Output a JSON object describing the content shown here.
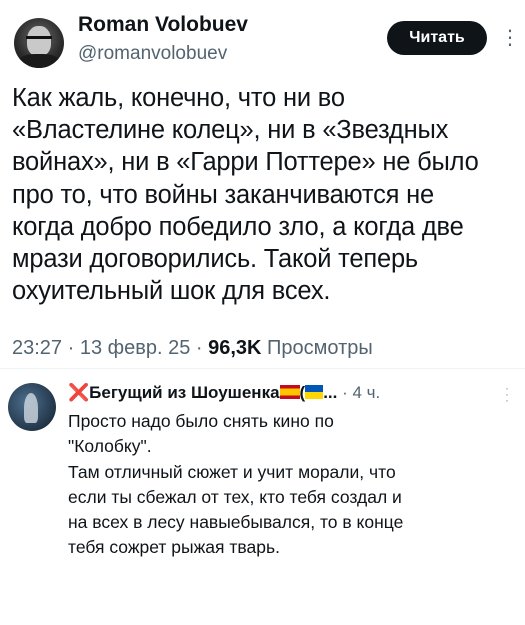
{
  "tweet": {
    "author_name": "Roman Volobuev",
    "author_handle": "@romanvolobuev",
    "follow_label": "Читать",
    "more_icon": "more-icon",
    "lines": [
      "Как жаль, конечно, что ни во",
      "«Властелине колец», ни в «Звездных",
      "войнах», ни в «Гарри Поттере» не было",
      "про то, что войны заканчиваются не",
      "когда добро победило зло, а когда две",
      "мрази договорились. Такой теперь",
      "охуительный шок для всех."
    ],
    "time": "23:27 · 13 февр. 25 · ",
    "views_count": "96,3K",
    "views_label": " Просмотры"
  },
  "reply": {
    "x_mark": "❌",
    "name": "Бегущий из Шоушенка",
    "name_suffix": "(",
    "ellipsis": "...",
    "time": " · 4 ч.",
    "lines": [
      "Просто надо было снять кино по",
      "\"Колобку\".",
      "Там отличный сюжет и учит морали, что",
      "если ты сбежал от тех, кто тебя создал и",
      "на всех в лесу навыебывался, то в конце",
      "тебя сожрет рыжая тварь."
    ]
  }
}
